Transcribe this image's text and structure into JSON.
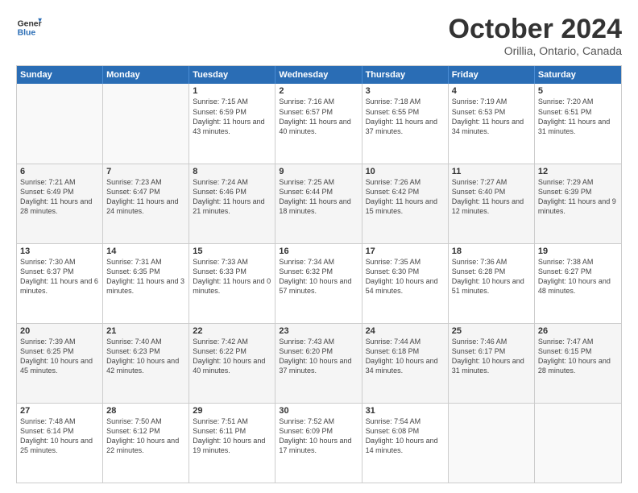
{
  "logo": {
    "general": "General",
    "blue": "Blue"
  },
  "title": "October 2024",
  "subtitle": "Orillia, Ontario, Canada",
  "days": [
    "Sunday",
    "Monday",
    "Tuesday",
    "Wednesday",
    "Thursday",
    "Friday",
    "Saturday"
  ],
  "weeks": [
    [
      {
        "day": "",
        "info": ""
      },
      {
        "day": "",
        "info": ""
      },
      {
        "day": "1",
        "info": "Sunrise: 7:15 AM\nSunset: 6:59 PM\nDaylight: 11 hours and 43 minutes."
      },
      {
        "day": "2",
        "info": "Sunrise: 7:16 AM\nSunset: 6:57 PM\nDaylight: 11 hours and 40 minutes."
      },
      {
        "day": "3",
        "info": "Sunrise: 7:18 AM\nSunset: 6:55 PM\nDaylight: 11 hours and 37 minutes."
      },
      {
        "day": "4",
        "info": "Sunrise: 7:19 AM\nSunset: 6:53 PM\nDaylight: 11 hours and 34 minutes."
      },
      {
        "day": "5",
        "info": "Sunrise: 7:20 AM\nSunset: 6:51 PM\nDaylight: 11 hours and 31 minutes."
      }
    ],
    [
      {
        "day": "6",
        "info": "Sunrise: 7:21 AM\nSunset: 6:49 PM\nDaylight: 11 hours and 28 minutes."
      },
      {
        "day": "7",
        "info": "Sunrise: 7:23 AM\nSunset: 6:47 PM\nDaylight: 11 hours and 24 minutes."
      },
      {
        "day": "8",
        "info": "Sunrise: 7:24 AM\nSunset: 6:46 PM\nDaylight: 11 hours and 21 minutes."
      },
      {
        "day": "9",
        "info": "Sunrise: 7:25 AM\nSunset: 6:44 PM\nDaylight: 11 hours and 18 minutes."
      },
      {
        "day": "10",
        "info": "Sunrise: 7:26 AM\nSunset: 6:42 PM\nDaylight: 11 hours and 15 minutes."
      },
      {
        "day": "11",
        "info": "Sunrise: 7:27 AM\nSunset: 6:40 PM\nDaylight: 11 hours and 12 minutes."
      },
      {
        "day": "12",
        "info": "Sunrise: 7:29 AM\nSunset: 6:39 PM\nDaylight: 11 hours and 9 minutes."
      }
    ],
    [
      {
        "day": "13",
        "info": "Sunrise: 7:30 AM\nSunset: 6:37 PM\nDaylight: 11 hours and 6 minutes."
      },
      {
        "day": "14",
        "info": "Sunrise: 7:31 AM\nSunset: 6:35 PM\nDaylight: 11 hours and 3 minutes."
      },
      {
        "day": "15",
        "info": "Sunrise: 7:33 AM\nSunset: 6:33 PM\nDaylight: 11 hours and 0 minutes."
      },
      {
        "day": "16",
        "info": "Sunrise: 7:34 AM\nSunset: 6:32 PM\nDaylight: 10 hours and 57 minutes."
      },
      {
        "day": "17",
        "info": "Sunrise: 7:35 AM\nSunset: 6:30 PM\nDaylight: 10 hours and 54 minutes."
      },
      {
        "day": "18",
        "info": "Sunrise: 7:36 AM\nSunset: 6:28 PM\nDaylight: 10 hours and 51 minutes."
      },
      {
        "day": "19",
        "info": "Sunrise: 7:38 AM\nSunset: 6:27 PM\nDaylight: 10 hours and 48 minutes."
      }
    ],
    [
      {
        "day": "20",
        "info": "Sunrise: 7:39 AM\nSunset: 6:25 PM\nDaylight: 10 hours and 45 minutes."
      },
      {
        "day": "21",
        "info": "Sunrise: 7:40 AM\nSunset: 6:23 PM\nDaylight: 10 hours and 42 minutes."
      },
      {
        "day": "22",
        "info": "Sunrise: 7:42 AM\nSunset: 6:22 PM\nDaylight: 10 hours and 40 minutes."
      },
      {
        "day": "23",
        "info": "Sunrise: 7:43 AM\nSunset: 6:20 PM\nDaylight: 10 hours and 37 minutes."
      },
      {
        "day": "24",
        "info": "Sunrise: 7:44 AM\nSunset: 6:18 PM\nDaylight: 10 hours and 34 minutes."
      },
      {
        "day": "25",
        "info": "Sunrise: 7:46 AM\nSunset: 6:17 PM\nDaylight: 10 hours and 31 minutes."
      },
      {
        "day": "26",
        "info": "Sunrise: 7:47 AM\nSunset: 6:15 PM\nDaylight: 10 hours and 28 minutes."
      }
    ],
    [
      {
        "day": "27",
        "info": "Sunrise: 7:48 AM\nSunset: 6:14 PM\nDaylight: 10 hours and 25 minutes."
      },
      {
        "day": "28",
        "info": "Sunrise: 7:50 AM\nSunset: 6:12 PM\nDaylight: 10 hours and 22 minutes."
      },
      {
        "day": "29",
        "info": "Sunrise: 7:51 AM\nSunset: 6:11 PM\nDaylight: 10 hours and 19 minutes."
      },
      {
        "day": "30",
        "info": "Sunrise: 7:52 AM\nSunset: 6:09 PM\nDaylight: 10 hours and 17 minutes."
      },
      {
        "day": "31",
        "info": "Sunrise: 7:54 AM\nSunset: 6:08 PM\nDaylight: 10 hours and 14 minutes."
      },
      {
        "day": "",
        "info": ""
      },
      {
        "day": "",
        "info": ""
      }
    ]
  ]
}
